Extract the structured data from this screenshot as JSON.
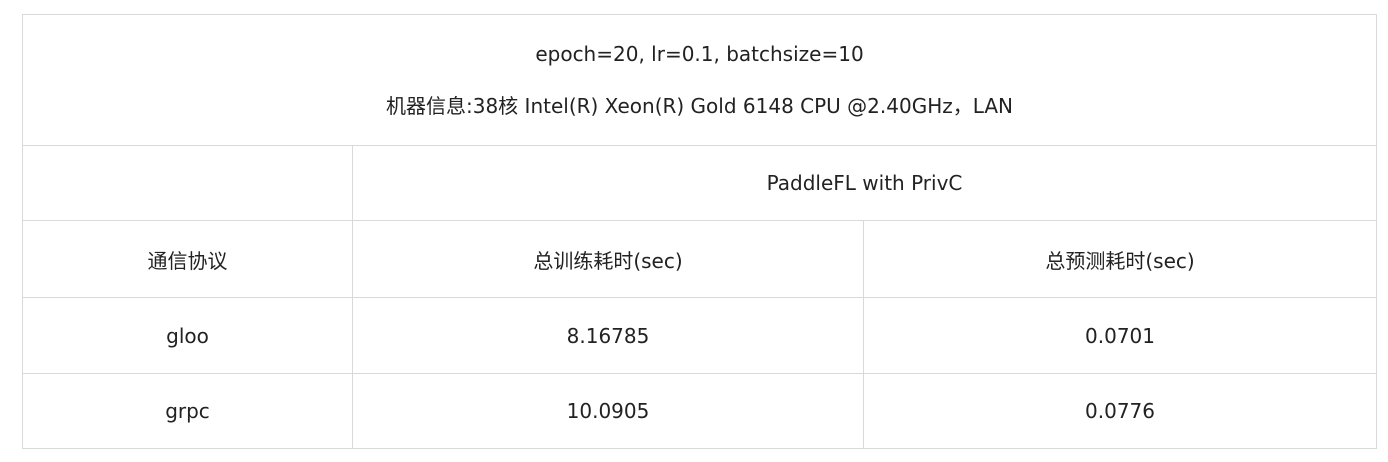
{
  "table": {
    "config_line": "epoch=20, lr=0.1, batchsize=10",
    "machine_line": "机器信息:38核 Intel(R) Xeon(R) Gold 6148 CPU @2.40GHz，LAN",
    "group_header": "PaddleFL with PrivC",
    "columns": [
      "通信协议",
      "总训练耗时(sec)",
      "总预测耗时(sec)"
    ],
    "rows": [
      {
        "protocol": "gloo",
        "train_time": "8.16785",
        "predict_time": "0.0701"
      },
      {
        "protocol": "grpc",
        "train_time": "10.0905",
        "predict_time": "0.0776"
      }
    ]
  }
}
